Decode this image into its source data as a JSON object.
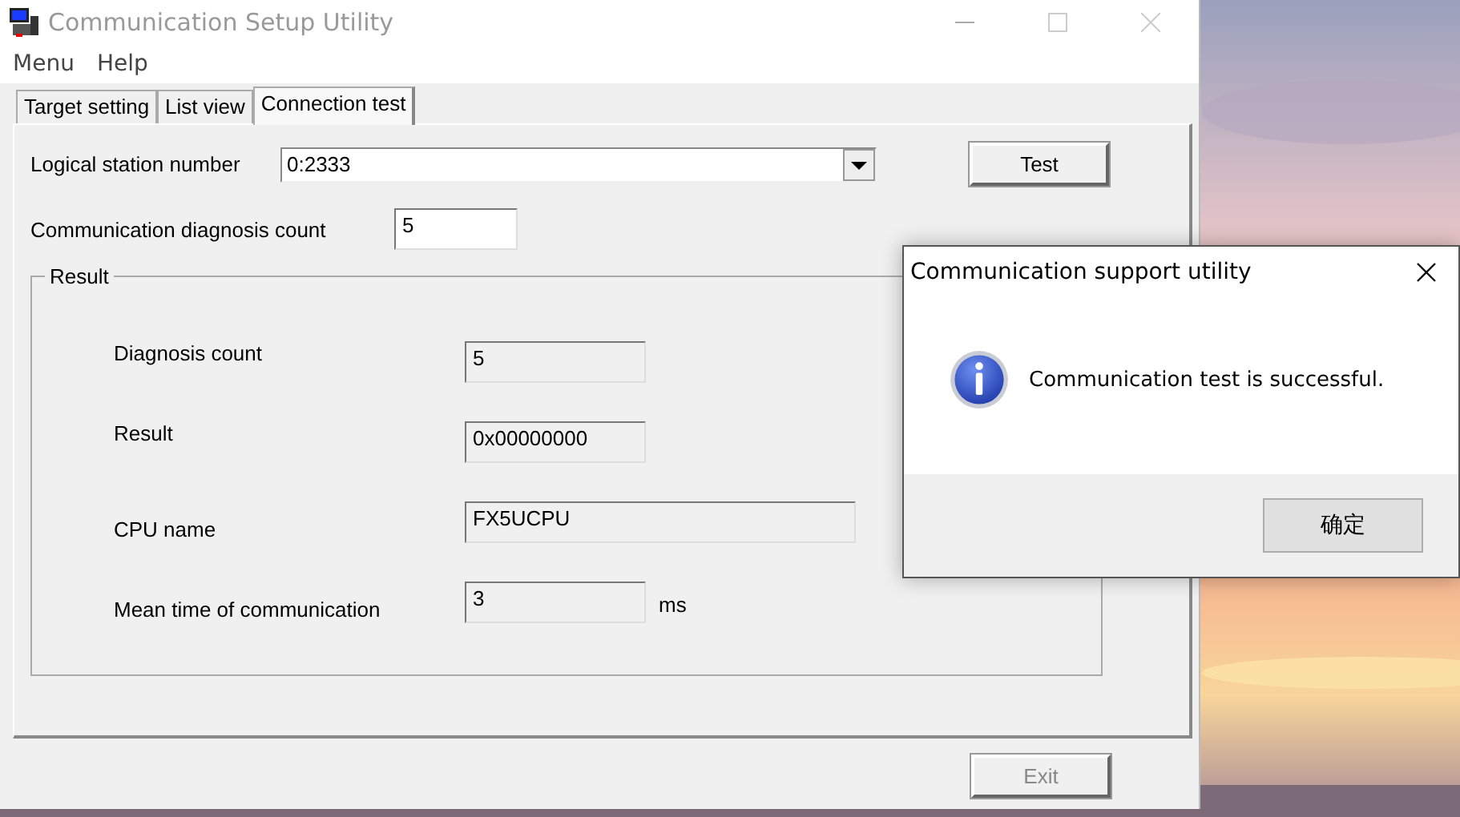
{
  "main_window": {
    "title": "Communication Setup Utility",
    "active": false
  },
  "menu": [
    "Menu",
    "Help"
  ],
  "tabs": [
    {
      "label": "Target setting",
      "selected": false
    },
    {
      "label": "List view",
      "selected": false
    },
    {
      "label": "Connection test",
      "selected": true
    }
  ],
  "station": {
    "label": "Logical station number",
    "value": "0:2333"
  },
  "test_button": "Test",
  "count": {
    "label": "Communication diagnosis count",
    "value": "5"
  },
  "result_group": {
    "title": "Result",
    "rows": [
      {
        "label": "Diagnosis count",
        "value": "5",
        "kind": "narrow"
      },
      {
        "label": "Result",
        "value": "0x00000000",
        "kind": "narrow"
      },
      {
        "label": "CPU name",
        "value": "FX5UCPU",
        "kind": "wide"
      },
      {
        "label": "Mean time of communication",
        "value": "3",
        "kind": "narrow",
        "unit": "ms"
      }
    ]
  },
  "exit_button": {
    "label": "Exit",
    "disabled": true
  },
  "dialog": {
    "title": "Communication support utility",
    "message": "Communication test is successful.",
    "ok_button": "确定"
  }
}
